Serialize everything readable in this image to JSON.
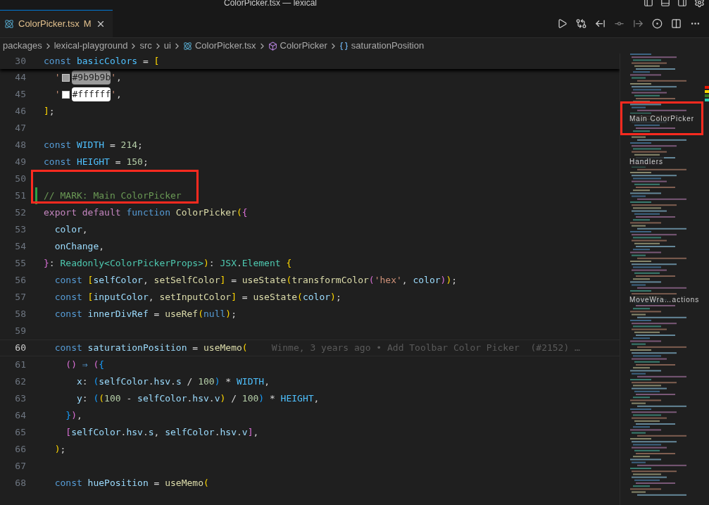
{
  "window": {
    "title": "ColorPicker.tsx — lexical"
  },
  "tabs": [
    {
      "label": "ColorPicker.tsx",
      "badge": "M",
      "selected": true,
      "modified": true
    }
  ],
  "breadcrumbs": [
    {
      "label": "packages",
      "kind": "folder"
    },
    {
      "label": "lexical-playground",
      "kind": "folder"
    },
    {
      "label": "src",
      "kind": "folder"
    },
    {
      "label": "ui",
      "kind": "folder"
    },
    {
      "label": "ColorPicker.tsx",
      "kind": "file"
    },
    {
      "label": "ColorPicker",
      "kind": "component"
    },
    {
      "label": "saturationPosition",
      "kind": "variable"
    }
  ],
  "sticky_line": {
    "number": "30",
    "tokens": [
      {
        "text": "const",
        "kind": "k"
      },
      {
        "text": " basicColors",
        "kind": "c"
      },
      {
        "text": " = ",
        "kind": "p"
      },
      {
        "text": "[",
        "kind": "b1"
      }
    ]
  },
  "lines": [
    {
      "number": "44",
      "tokens": [
        {
          "text": "  '",
          "kind": "s"
        },
        {
          "text": "#9b9b9b",
          "kind": "color",
          "color": "#9b9b9b"
        },
        {
          "text": "'",
          "kind": "s"
        },
        {
          "text": ",",
          "kind": "p"
        }
      ]
    },
    {
      "number": "45",
      "tokens": [
        {
          "text": "  '",
          "kind": "s"
        },
        {
          "text": "#ffffff",
          "kind": "color",
          "color": "#ffffff"
        },
        {
          "text": "'",
          "kind": "s"
        },
        {
          "text": ",",
          "kind": "p"
        }
      ]
    },
    {
      "number": "46",
      "tokens": [
        {
          "text": "]",
          "kind": "b1"
        },
        {
          "text": ";",
          "kind": "p"
        }
      ]
    },
    {
      "number": "47"
    },
    {
      "number": "48",
      "tokens": [
        {
          "text": "const",
          "kind": "k"
        },
        {
          "text": " WIDTH",
          "kind": "c"
        },
        {
          "text": " = ",
          "kind": "p"
        },
        {
          "text": "214",
          "kind": "n"
        },
        {
          "text": ";",
          "kind": "p"
        }
      ]
    },
    {
      "number": "49",
      "tokens": [
        {
          "text": "const",
          "kind": "k"
        },
        {
          "text": " HEIGHT",
          "kind": "c"
        },
        {
          "text": " = ",
          "kind": "p"
        },
        {
          "text": "150",
          "kind": "n"
        },
        {
          "text": ";",
          "kind": "p"
        }
      ]
    },
    {
      "number": "50"
    },
    {
      "number": "51",
      "modified": true,
      "highlighted": true,
      "tokens": [
        {
          "text": "// MARK: Main ColorPicker",
          "kind": "cm"
        }
      ]
    },
    {
      "number": "52",
      "tokens": [
        {
          "text": "export default",
          "kind": "kc"
        },
        {
          "text": " function",
          "kind": "k"
        },
        {
          "text": " ColorPicker",
          "kind": "f"
        },
        {
          "text": "(",
          "kind": "b1"
        },
        {
          "text": "{",
          "kind": "b2"
        }
      ]
    },
    {
      "number": "53",
      "tokens": [
        {
          "text": "  color",
          "kind": "v"
        },
        {
          "text": ",",
          "kind": "p"
        }
      ]
    },
    {
      "number": "54",
      "tokens": [
        {
          "text": "  onChange",
          "kind": "v"
        },
        {
          "text": ",",
          "kind": "p"
        }
      ]
    },
    {
      "number": "55",
      "tokens": [
        {
          "text": "}",
          "kind": "b2"
        },
        {
          "text": ": ",
          "kind": "p"
        },
        {
          "text": "Readonly",
          "kind": "t"
        },
        {
          "text": "<",
          "kind": "t"
        },
        {
          "text": "ColorPickerProps",
          "kind": "t"
        },
        {
          "text": ">",
          "kind": "t"
        },
        {
          "text": ")",
          "kind": "b1"
        },
        {
          "text": ": ",
          "kind": "p"
        },
        {
          "text": "JSX",
          "kind": "t"
        },
        {
          "text": ".",
          "kind": "p"
        },
        {
          "text": "Element",
          "kind": "t"
        },
        {
          "text": " {",
          "kind": "b1"
        }
      ]
    },
    {
      "number": "56",
      "tokens": [
        {
          "text": "  const",
          "kind": "k"
        },
        {
          "text": " [",
          "kind": "b1"
        },
        {
          "text": "selfColor",
          "kind": "v"
        },
        {
          "text": ", ",
          "kind": "p"
        },
        {
          "text": "setSelfColor",
          "kind": "f"
        },
        {
          "text": "]",
          "kind": "b1"
        },
        {
          "text": " = ",
          "kind": "p"
        },
        {
          "text": "useState",
          "kind": "f"
        },
        {
          "text": "(",
          "kind": "b1"
        },
        {
          "text": "transformColor",
          "kind": "f"
        },
        {
          "text": "(",
          "kind": "b2"
        },
        {
          "text": "'hex'",
          "kind": "s"
        },
        {
          "text": ", ",
          "kind": "p"
        },
        {
          "text": "color",
          "kind": "v"
        },
        {
          "text": ")",
          "kind": "b2"
        },
        {
          "text": ")",
          "kind": "b1"
        },
        {
          "text": ";",
          "kind": "p"
        }
      ]
    },
    {
      "number": "57",
      "tokens": [
        {
          "text": "  const",
          "kind": "k"
        },
        {
          "text": " [",
          "kind": "b1"
        },
        {
          "text": "inputColor",
          "kind": "v"
        },
        {
          "text": ", ",
          "kind": "p"
        },
        {
          "text": "setInputColor",
          "kind": "f"
        },
        {
          "text": "]",
          "kind": "b1"
        },
        {
          "text": " = ",
          "kind": "p"
        },
        {
          "text": "useState",
          "kind": "f"
        },
        {
          "text": "(",
          "kind": "b1"
        },
        {
          "text": "color",
          "kind": "v"
        },
        {
          "text": ")",
          "kind": "b1"
        },
        {
          "text": ";",
          "kind": "p"
        }
      ]
    },
    {
      "number": "58",
      "tokens": [
        {
          "text": "  const",
          "kind": "k"
        },
        {
          "text": " innerDivRef",
          "kind": "v"
        },
        {
          "text": " = ",
          "kind": "p"
        },
        {
          "text": "useRef",
          "kind": "f"
        },
        {
          "text": "(",
          "kind": "b1"
        },
        {
          "text": "null",
          "kind": "k"
        },
        {
          "text": ")",
          "kind": "b1"
        },
        {
          "text": ";",
          "kind": "p"
        }
      ]
    },
    {
      "number": "59"
    },
    {
      "number": "60",
      "current": true,
      "blame": "Winme, 3 years ago • Add Toolbar Color Picker  (#2152) …",
      "tokens": [
        {
          "text": "  const",
          "kind": "k"
        },
        {
          "text": " saturationPosition",
          "kind": "v"
        },
        {
          "text": " = ",
          "kind": "p"
        },
        {
          "text": "useMemo",
          "kind": "f"
        },
        {
          "text": "(",
          "kind": "b1"
        }
      ]
    },
    {
      "number": "61",
      "tokens": [
        {
          "text": "    ()",
          "kind": "b2"
        },
        {
          "text": " ⇒ ",
          "kind": "k"
        },
        {
          "text": "(",
          "kind": "b2"
        },
        {
          "text": "{",
          "kind": "b3"
        }
      ]
    },
    {
      "number": "62",
      "tokens": [
        {
          "text": "      x",
          "kind": "v"
        },
        {
          "text": ": ",
          "kind": "p"
        },
        {
          "text": "(",
          "kind": "b3"
        },
        {
          "text": "selfColor",
          "kind": "v"
        },
        {
          "text": ".",
          "kind": "p"
        },
        {
          "text": "hsv",
          "kind": "v"
        },
        {
          "text": ".",
          "kind": "p"
        },
        {
          "text": "s",
          "kind": "v"
        },
        {
          "text": " / ",
          "kind": "p"
        },
        {
          "text": "100",
          "kind": "n"
        },
        {
          "text": ")",
          "kind": "b3"
        },
        {
          "text": " * ",
          "kind": "p"
        },
        {
          "text": "WIDTH",
          "kind": "c"
        },
        {
          "text": ",",
          "kind": "p"
        }
      ]
    },
    {
      "number": "63",
      "tokens": [
        {
          "text": "      y",
          "kind": "v"
        },
        {
          "text": ": ",
          "kind": "p"
        },
        {
          "text": "(",
          "kind": "b3"
        },
        {
          "text": "(",
          "kind": "b1"
        },
        {
          "text": "100",
          "kind": "n"
        },
        {
          "text": " - ",
          "kind": "p"
        },
        {
          "text": "selfColor",
          "kind": "v"
        },
        {
          "text": ".",
          "kind": "p"
        },
        {
          "text": "hsv",
          "kind": "v"
        },
        {
          "text": ".",
          "kind": "p"
        },
        {
          "text": "v",
          "kind": "v"
        },
        {
          "text": ")",
          "kind": "b1"
        },
        {
          "text": " / ",
          "kind": "p"
        },
        {
          "text": "100",
          "kind": "n"
        },
        {
          "text": ")",
          "kind": "b3"
        },
        {
          "text": " * ",
          "kind": "p"
        },
        {
          "text": "HEIGHT",
          "kind": "c"
        },
        {
          "text": ",",
          "kind": "p"
        }
      ]
    },
    {
      "number": "64",
      "tokens": [
        {
          "text": "    }",
          "kind": "b3"
        },
        {
          "text": ")",
          "kind": "b2"
        },
        {
          "text": ",",
          "kind": "p"
        }
      ]
    },
    {
      "number": "65",
      "tokens": [
        {
          "text": "    [",
          "kind": "b2"
        },
        {
          "text": "selfColor",
          "kind": "v"
        },
        {
          "text": ".",
          "kind": "p"
        },
        {
          "text": "hsv",
          "kind": "v"
        },
        {
          "text": ".",
          "kind": "p"
        },
        {
          "text": "s",
          "kind": "v"
        },
        {
          "text": ", ",
          "kind": "p"
        },
        {
          "text": "selfColor",
          "kind": "v"
        },
        {
          "text": ".",
          "kind": "p"
        },
        {
          "text": "hsv",
          "kind": "v"
        },
        {
          "text": ".",
          "kind": "p"
        },
        {
          "text": "v",
          "kind": "v"
        },
        {
          "text": "]",
          "kind": "b2"
        },
        {
          "text": ",",
          "kind": "p"
        }
      ]
    },
    {
      "number": "66",
      "tokens": [
        {
          "text": "  )",
          "kind": "b1"
        },
        {
          "text": ";",
          "kind": "p"
        }
      ]
    },
    {
      "number": "67"
    },
    {
      "number": "68",
      "tokens": [
        {
          "text": "  const",
          "kind": "k"
        },
        {
          "text": " huePosition",
          "kind": "v"
        },
        {
          "text": " = ",
          "kind": "p"
        },
        {
          "text": "useMemo",
          "kind": "f"
        },
        {
          "text": "(",
          "kind": "b1"
        }
      ]
    }
  ],
  "minimap": {
    "sections": [
      {
        "label": "Main ColorPicker",
        "highlighted": true
      },
      {
        "label": "Handlers",
        "highlighted": false
      },
      {
        "label": "MoveWra…actions",
        "highlighted": false
      }
    ]
  }
}
